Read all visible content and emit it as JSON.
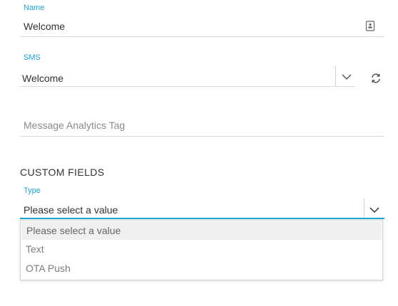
{
  "name_field": {
    "label": "Name",
    "value": "Welcome",
    "icon": "contact-card-icon"
  },
  "sms_field": {
    "label": "SMS",
    "value": "Welcome",
    "dropdown_icon": "chevron-down-icon",
    "refresh_icon": "refresh-icon"
  },
  "analytics_field": {
    "placeholder": "Message Analytics Tag"
  },
  "custom_fields": {
    "heading": "CUSTOM FIELDS",
    "type_field": {
      "label": "Type",
      "value": "Please select a value",
      "options": [
        "Please select a value",
        "Text",
        "OTA Push"
      ],
      "highlighted_option": "Please select a value"
    }
  },
  "colors": {
    "accent": "#1ba3d6",
    "border": "#d9d9d9",
    "highlight": "#f0f0f0"
  }
}
